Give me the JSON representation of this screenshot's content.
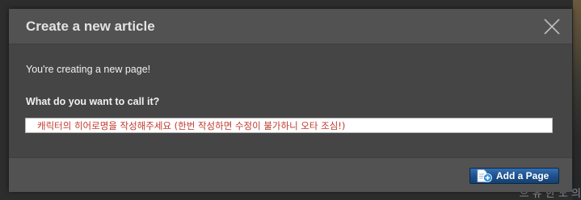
{
  "background": {
    "partial_text": "으 유 한  노 의"
  },
  "dialog": {
    "title": "Create a new article",
    "intro": "You're creating a new page!",
    "field_label": "What do you want to call it?",
    "input": {
      "value": "",
      "placeholder": "캐릭터의 히어로명을 작성해주세요 (한번 작성하면 수정이 불가하니 오타 조심!)"
    },
    "add_button_label": "Add a Page"
  },
  "colors": {
    "overlay": "#2d2d2d",
    "dialog_body": "#454545",
    "dialog_header": "#525252",
    "placeholder_text": "#c0392b",
    "button_blue": "#1d4f8a"
  },
  "icons": {
    "close": "close-icon",
    "add_page": "add-page-icon"
  }
}
